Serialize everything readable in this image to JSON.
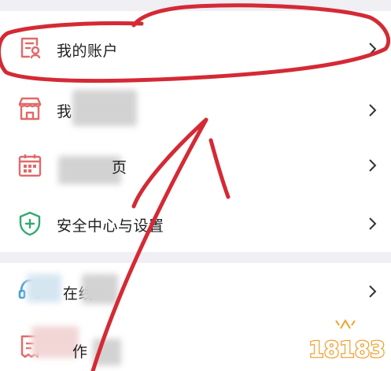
{
  "menu": {
    "items": [
      {
        "label": "我的账户",
        "icon": "account-document-icon"
      },
      {
        "label": "我",
        "icon": "store-icon"
      },
      {
        "label": "页",
        "icon": "calendar-icon"
      },
      {
        "label": "安全中心与设置",
        "icon": "shield-plus-icon"
      },
      {
        "label": "在线",
        "icon": "headset-icon"
      },
      {
        "label": "作",
        "icon": "receipt-icon"
      }
    ],
    "chevron_icon": "chevron-right-icon"
  },
  "watermark": {
    "text": "18183"
  },
  "colors": {
    "icon_red": "#e06a68",
    "icon_green": "#2faa72",
    "icon_blue": "#4a9fd8",
    "annotation_red": "#d42a35",
    "watermark_orange": "#f0a030"
  }
}
